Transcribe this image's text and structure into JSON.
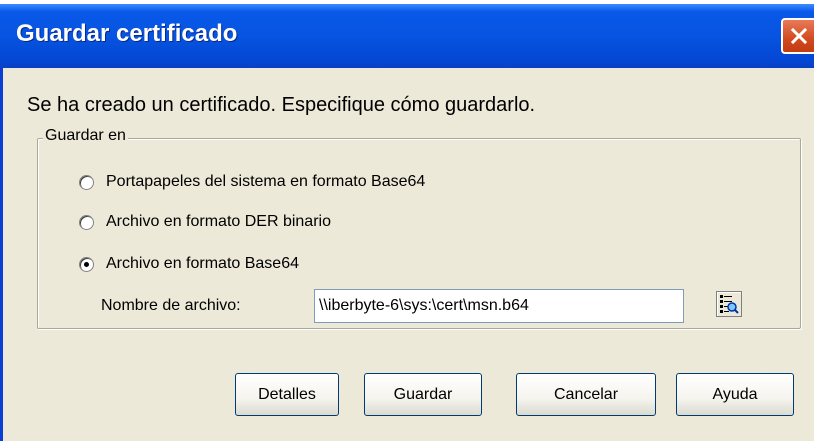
{
  "window": {
    "title": "Guardar certificado"
  },
  "message": "Se ha creado un certificado. Especifique cómo guardarlo.",
  "group": {
    "legend": "Guardar en",
    "options": [
      {
        "label": "Portapapeles del sistema en formato Base64",
        "selected": false
      },
      {
        "label": "Archivo en formato DER binario",
        "selected": false
      },
      {
        "label": "Archivo en formato Base64",
        "selected": true
      }
    ],
    "file_label": "Nombre de archivo:",
    "file_value": "\\\\iberbyte-6\\sys:\\cert\\msn.b64",
    "browse_icon": "browse-file-icon"
  },
  "buttons": {
    "details": "Detalles",
    "save": "Guardar",
    "cancel": "Cancelar",
    "help": "Ayuda"
  },
  "colors": {
    "titlebar": "#0654e0",
    "close": "#d24a1e",
    "face": "#ece9d8"
  }
}
